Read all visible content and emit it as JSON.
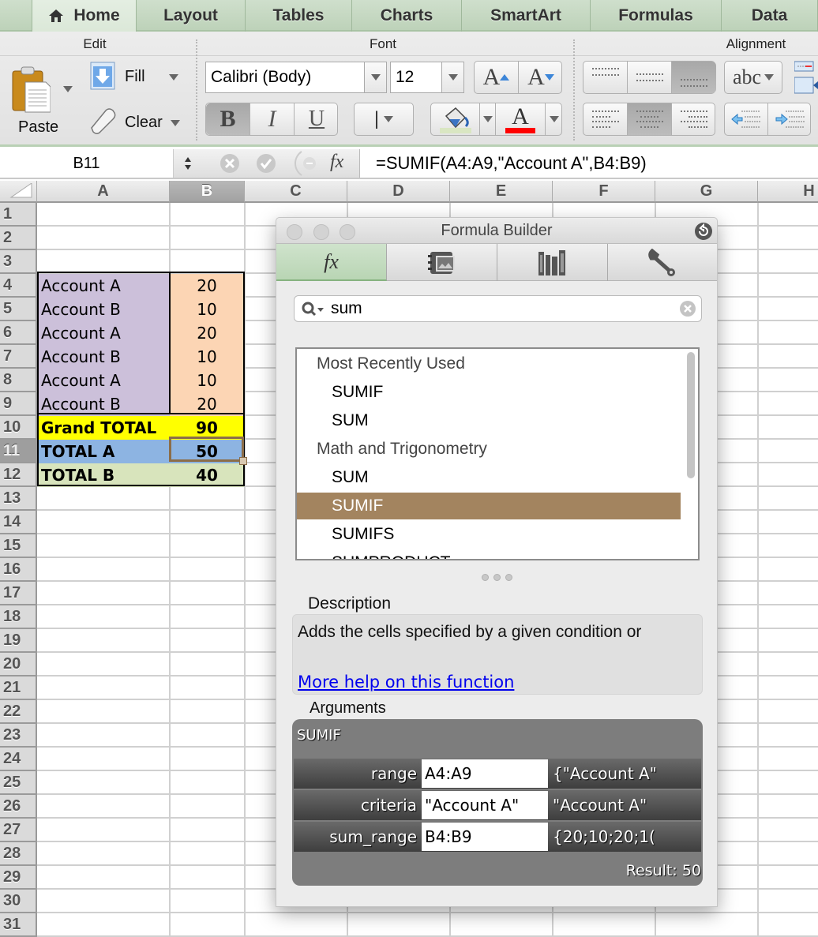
{
  "tabs": [
    {
      "label": "Home",
      "icon": "home-icon",
      "active": true
    },
    {
      "label": "Layout"
    },
    {
      "label": "Tables"
    },
    {
      "label": "Charts"
    },
    {
      "label": "SmartArt"
    },
    {
      "label": "Formulas"
    },
    {
      "label": "Data"
    }
  ],
  "ribbon": {
    "edit": {
      "title": "Edit",
      "paste": "Paste",
      "fill": "Fill",
      "clear": "Clear"
    },
    "font": {
      "title": "Font",
      "font_name": "Calibri (Body)",
      "font_size": "12",
      "bold": "B",
      "italic": "I",
      "underline": "U",
      "grow": "A",
      "shrink": "A",
      "font_color_glyph": "A",
      "fill_color": "#d9e6c2",
      "font_color": "#ff0000"
    },
    "alignment": {
      "title": "Alignment",
      "wrap": "abc"
    }
  },
  "formula_bar": {
    "name_box": "B11",
    "fx": "fx",
    "formula": "=SUMIF(A4:A9,\"Account A\",B4:B9)"
  },
  "sheet": {
    "columns": [
      "A",
      "B",
      "C",
      "D",
      "E",
      "F",
      "G",
      "H"
    ],
    "selected_column": "B",
    "selected_row": 11,
    "rows": [
      "1",
      "2",
      "3",
      "4",
      "5",
      "6",
      "7",
      "8",
      "9",
      "10",
      "11",
      "12",
      "13",
      "14",
      "15",
      "16",
      "17",
      "18",
      "19",
      "20",
      "21",
      "22",
      "23",
      "24",
      "25",
      "26",
      "27",
      "28",
      "29",
      "30",
      "31"
    ],
    "data": [
      {
        "row": 4,
        "a": "Account A",
        "b": "20"
      },
      {
        "row": 5,
        "a": "Account B",
        "b": "10"
      },
      {
        "row": 6,
        "a": "Account A",
        "b": "20"
      },
      {
        "row": 7,
        "a": "Account B",
        "b": "10"
      },
      {
        "row": 8,
        "a": "Account A",
        "b": "10"
      },
      {
        "row": 9,
        "a": "Account B",
        "b": "20"
      },
      {
        "row": 10,
        "a": "Grand TOTAL",
        "b": "90"
      },
      {
        "row": 11,
        "a": "TOTAL A",
        "b": "50"
      },
      {
        "row": 12,
        "a": "TOTAL B",
        "b": "40"
      }
    ],
    "colors": {
      "account_a_col": "#ccc0da",
      "account_b_col": "#fcd5b4",
      "grand_total": "#ffff00",
      "total_a": "#8db4e2",
      "total_b": "#d8e4bc",
      "selection": "#8b6d49"
    }
  },
  "formula_builder": {
    "title": "Formula Builder",
    "tabs": [
      "fx-icon",
      "media-browser-icon",
      "reference-books-icon",
      "wrench-icon"
    ],
    "search_value": "sum",
    "list": [
      {
        "type": "header",
        "label": "Most Recently Used"
      },
      {
        "type": "fn",
        "label": "SUMIF"
      },
      {
        "type": "fn",
        "label": "SUM"
      },
      {
        "type": "header",
        "label": "Math and Trigonometry"
      },
      {
        "type": "fn",
        "label": "SUM"
      },
      {
        "type": "fn",
        "label": "SUMIF",
        "selected": true
      },
      {
        "type": "fn",
        "label": "SUMIFS"
      },
      {
        "type": "fn",
        "label": "SUMPRODUCT"
      }
    ],
    "description_label": "Description",
    "description_text": "Adds the cells specified by a given condition or",
    "help_link": "More help on this function",
    "arguments_label": "Arguments",
    "function_name": "SUMIF",
    "arguments": [
      {
        "name": "range",
        "value": "A4:A9",
        "evaluated": "{\"Account A\""
      },
      {
        "name": "criteria",
        "value": "\"Account A\"",
        "evaluated": "\"Account A\""
      },
      {
        "name": "sum_range",
        "value": "B4:B9",
        "evaluated": "{20;10;20;1("
      }
    ],
    "result": "Result: 50"
  }
}
